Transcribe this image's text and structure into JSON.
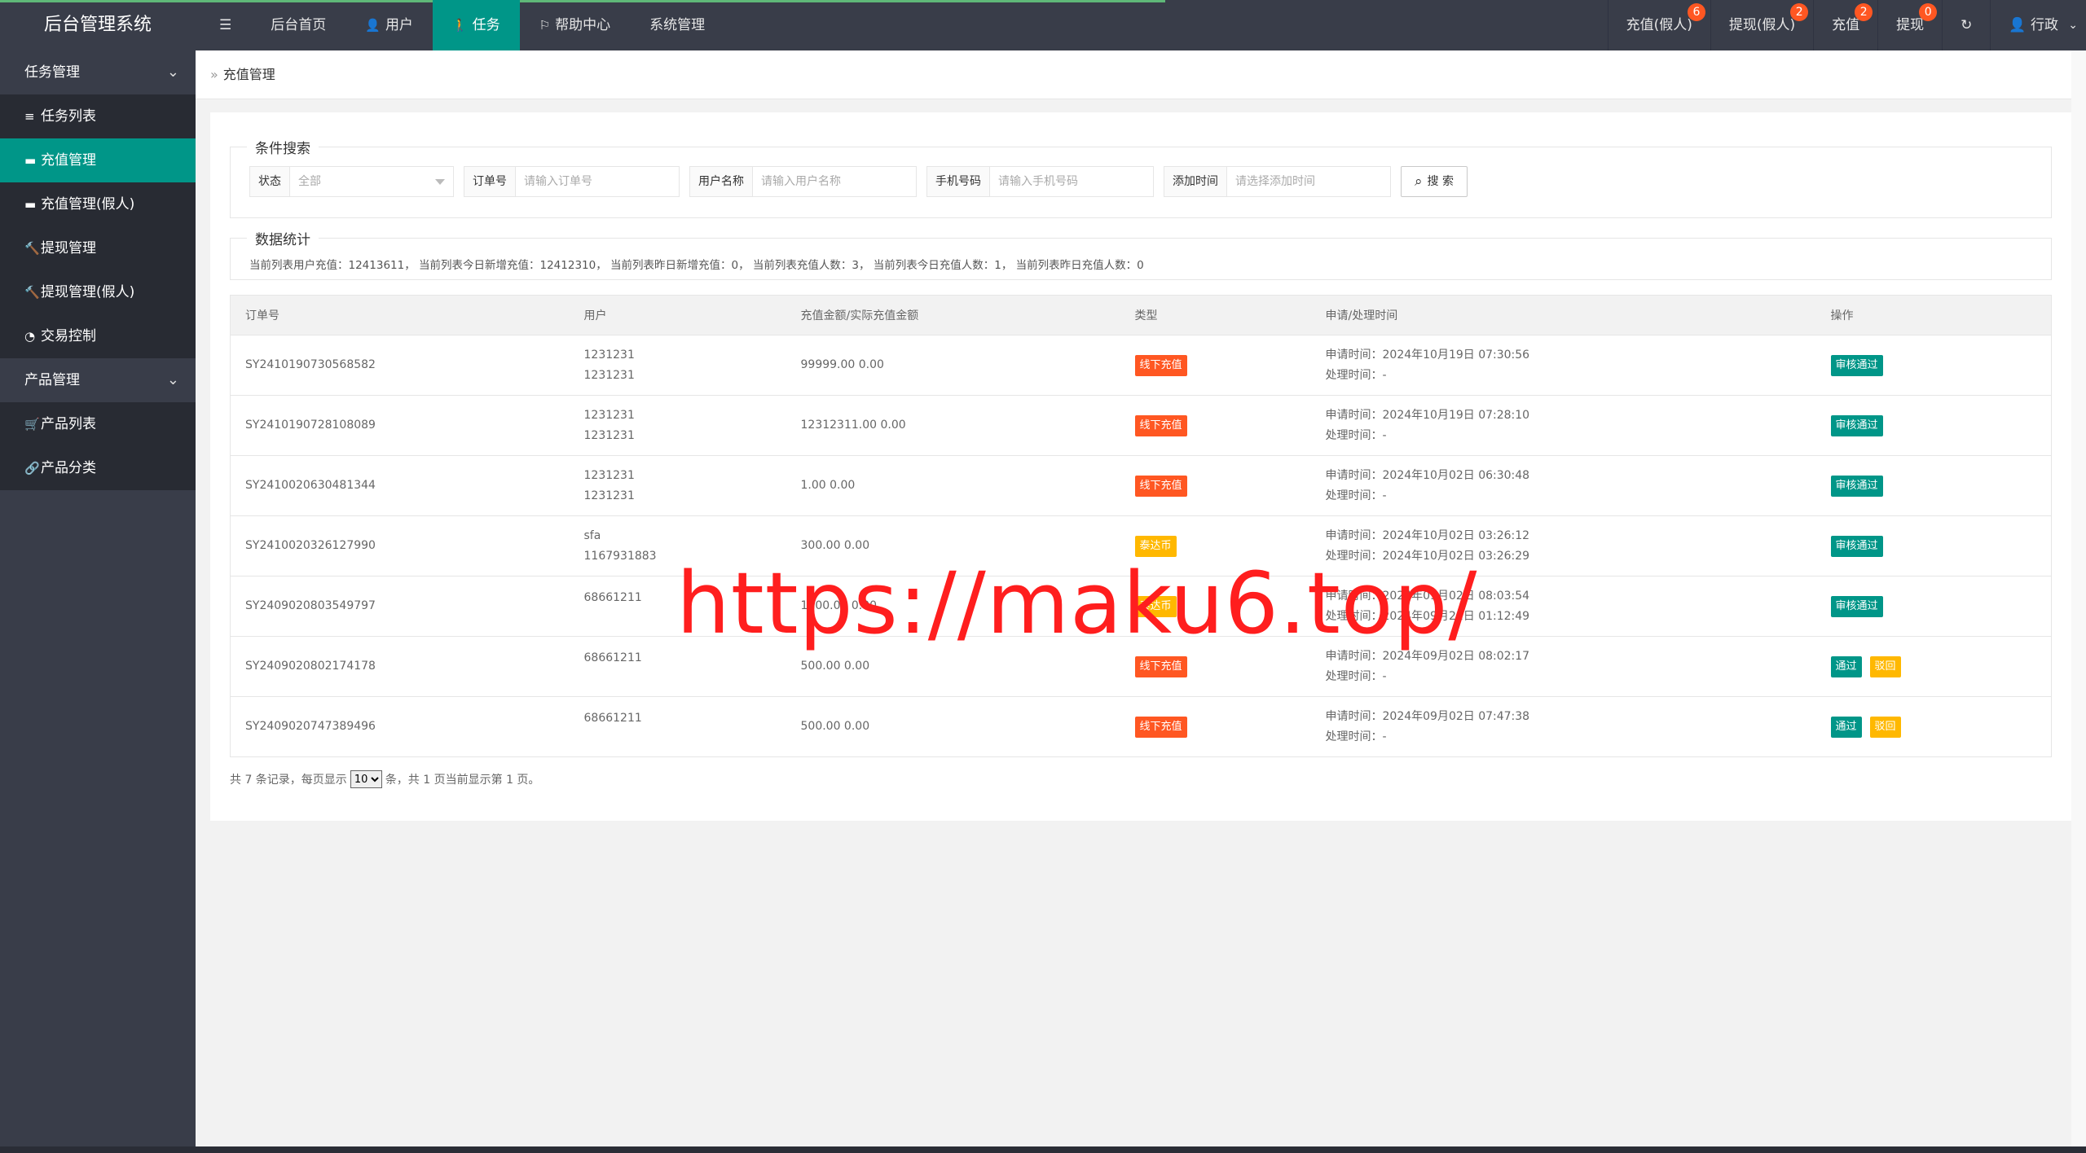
{
  "app": {
    "title": "后台管理系统"
  },
  "nav": [
    {
      "label": "后台首页",
      "icon": ""
    },
    {
      "label": "用户",
      "icon": "user-icon"
    },
    {
      "label": "任务",
      "icon": "walk-icon",
      "active": true
    },
    {
      "label": "帮助中心",
      "icon": "flag-icon"
    },
    {
      "label": "系统管理",
      "icon": ""
    }
  ],
  "nav_right": [
    {
      "label": "充值(假人)",
      "badge": "6"
    },
    {
      "label": "提现(假人)",
      "badge": "2"
    },
    {
      "label": "充值",
      "badge": "2"
    },
    {
      "label": "提现",
      "badge": "0"
    }
  ],
  "user_menu": {
    "label": "行政"
  },
  "sidebar": {
    "group1": "任务管理",
    "items1": [
      {
        "label": "任务列表",
        "icon": "list-icon"
      },
      {
        "label": "充值管理",
        "icon": "chat-icon",
        "active": true
      },
      {
        "label": "充值管理(假人)",
        "icon": "chat-icon"
      },
      {
        "label": "提现管理",
        "icon": "gavel-icon"
      },
      {
        "label": "提现管理(假人)",
        "icon": "gavel-icon"
      },
      {
        "label": "交易控制",
        "icon": "gauge-icon"
      }
    ],
    "group2": "产品管理",
    "items2": [
      {
        "label": "产品列表",
        "icon": "cart-icon"
      },
      {
        "label": "产品分类",
        "icon": "link-icon"
      }
    ]
  },
  "breadcrumb": {
    "current": "充值管理"
  },
  "search": {
    "legend": "条件搜索",
    "status_label": "状态",
    "status_value": "全部",
    "order_label": "订单号",
    "order_placeholder": "请输入订单号",
    "username_label": "用户名称",
    "username_placeholder": "请输入用户名称",
    "phone_label": "手机号码",
    "phone_placeholder": "请输入手机号码",
    "time_label": "添加时间",
    "time_placeholder": "请选择添加时间",
    "button": "搜 索"
  },
  "stats": {
    "legend": "数据统计",
    "text": "当前列表用户充值：12413611， 当前列表今日新增充值：12412310， 当前列表昨日新增充值：0， 当前列表充值人数：3， 当前列表今日充值人数：1， 当前列表昨日充值人数：0"
  },
  "table": {
    "headers": [
      "订单号",
      "用户",
      "充值金额/实际充值金额",
      "类型",
      "申请/处理时间",
      "操作"
    ],
    "rows": [
      {
        "order": "SY2410190730568582",
        "user1": "1231231",
        "user2": "1231231",
        "amount": "99999.00 0.00",
        "type": "线下充值",
        "type_color": "red",
        "apply": "申请时间：2024年10月19日 07:30:56",
        "process": "处理时间：-",
        "actions": [
          "审核通过"
        ]
      },
      {
        "order": "SY2410190728108089",
        "user1": "1231231",
        "user2": "1231231",
        "amount": "12312311.00 0.00",
        "type": "线下充值",
        "type_color": "red",
        "apply": "申请时间：2024年10月19日 07:28:10",
        "process": "处理时间：-",
        "actions": [
          "审核通过"
        ]
      },
      {
        "order": "SY2410020630481344",
        "user1": "1231231",
        "user2": "1231231",
        "amount": "1.00 0.00",
        "type": "线下充值",
        "type_color": "red",
        "apply": "申请时间：2024年10月02日 06:30:48",
        "process": "处理时间：-",
        "actions": [
          "审核通过"
        ]
      },
      {
        "order": "SY2410020326127990",
        "user1": "sfa",
        "user2": "1167931883",
        "amount": "300.00 0.00",
        "type": "泰达币",
        "type_color": "yellow",
        "apply": "申请时间：2024年10月02日 03:26:12",
        "process": "处理时间：2024年10月02日 03:26:29",
        "actions": [
          "审核通过"
        ]
      },
      {
        "order": "SY2409020803549797",
        "user1": "68661211",
        "user2": "",
        "amount": "1000.00 0.00",
        "type": "泰达币",
        "type_color": "yellow",
        "apply": "申请时间：2024年09月02日 08:03:54",
        "process": "处理时间：2024年09月21日 01:12:49",
        "actions": [
          "审核通过"
        ]
      },
      {
        "order": "SY2409020802174178",
        "user1": "68661211",
        "user2": "",
        "amount": "500.00 0.00",
        "type": "线下充值",
        "type_color": "red",
        "apply": "申请时间：2024年09月02日 08:02:17",
        "process": "处理时间：-",
        "actions": [
          "通过",
          "驳回"
        ]
      },
      {
        "order": "SY2409020747389496",
        "user1": "68661211",
        "user2": "",
        "amount": "500.00 0.00",
        "type": "线下充值",
        "type_color": "red",
        "apply": "申请时间：2024年09月02日 07:47:38",
        "process": "处理时间：-",
        "actions": [
          "通过",
          "驳回"
        ]
      }
    ]
  },
  "pager": {
    "prefix": "共 7 条记录，每页显示",
    "page_size": "10",
    "suffix": "条，共 1 页当前显示第 1 页。"
  },
  "watermark": "https://maku6.top/"
}
